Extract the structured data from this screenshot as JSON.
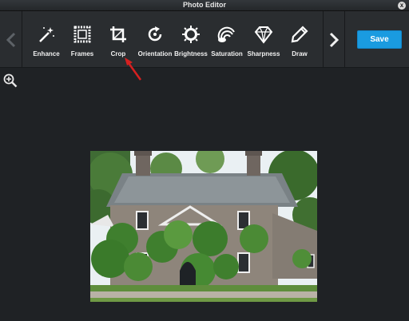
{
  "window": {
    "title": "Photo Editor",
    "close_label": "x"
  },
  "toolbar": {
    "tools": [
      {
        "label": "Enhance",
        "icon": "magic-wand-icon"
      },
      {
        "label": "Frames",
        "icon": "frame-icon"
      },
      {
        "label": "Crop",
        "icon": "crop-icon"
      },
      {
        "label": "Orientation",
        "icon": "rotate-icon"
      },
      {
        "label": "Brightness",
        "icon": "sun-icon"
      },
      {
        "label": "Saturation",
        "icon": "rainbow-icon"
      },
      {
        "label": "Sharpness",
        "icon": "diamond-icon"
      },
      {
        "label": "Draw",
        "icon": "pencil-icon"
      }
    ],
    "save_label": "Save",
    "accent_color": "#1a9be0",
    "annotation_color": "#d62020"
  },
  "canvas": {
    "zoom_icon": "zoom-in-icon",
    "photo_subject": "stone cottage covered in ivy"
  }
}
